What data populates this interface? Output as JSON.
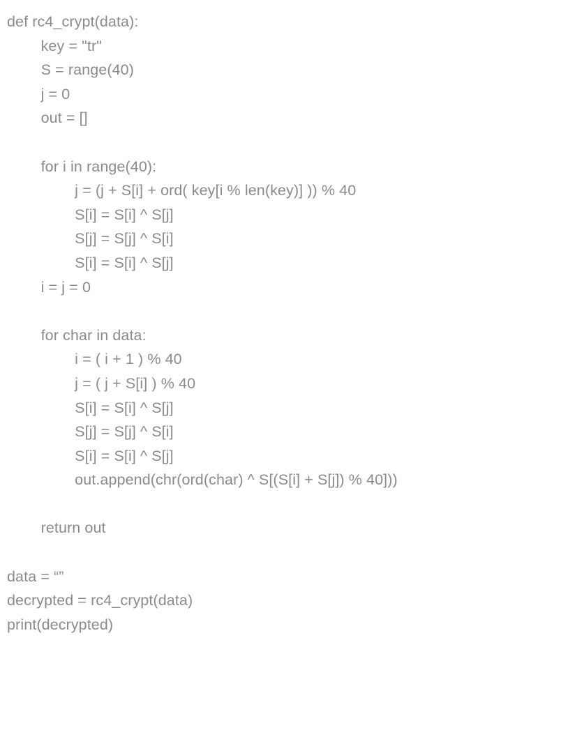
{
  "code": {
    "lines": [
      "def rc4_crypt(data):",
      "        key = \"tr\"",
      "        S = range(40)",
      "        j = 0",
      "        out = []",
      "",
      "        for i in range(40):",
      "                j = (j + S[i] + ord( key[i % len(key)] )) % 40",
      "                S[i] = S[i] ^ S[j]",
      "                S[j] = S[j] ^ S[i]",
      "                S[i] = S[i] ^ S[j]",
      "        i = j = 0",
      "",
      "        for char in data:",
      "                i = ( i + 1 ) % 40",
      "                j = ( j + S[i] ) % 40",
      "                S[i] = S[i] ^ S[j]",
      "                S[j] = S[j] ^ S[i]",
      "                S[i] = S[i] ^ S[j]",
      "                out.append(chr(ord(char) ^ S[(S[i] + S[j]) % 40]))",
      "",
      "        return out",
      "",
      "data = “”",
      "decrypted = rc4_crypt(data)",
      "print(decrypted)"
    ]
  }
}
